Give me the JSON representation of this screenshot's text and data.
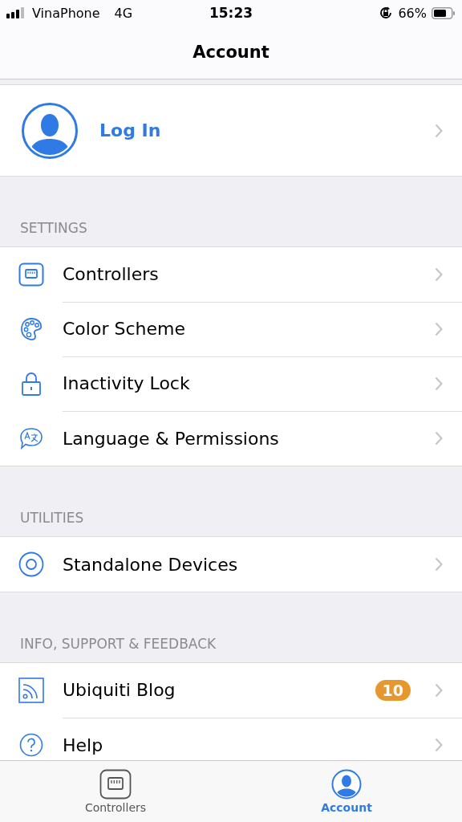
{
  "status_bar": {
    "carrier": "VinaPhone",
    "network": "4G",
    "time": "15:23",
    "battery": "66%"
  },
  "nav": {
    "title": "Account"
  },
  "login": {
    "label": "Log In"
  },
  "sections": [
    {
      "header": "SETTINGS",
      "items": [
        {
          "label": "Controllers"
        },
        {
          "label": "Color Scheme"
        },
        {
          "label": "Inactivity Lock"
        },
        {
          "label": "Language & Permissions"
        }
      ]
    },
    {
      "header": "UTILITIES",
      "items": [
        {
          "label": "Standalone Devices"
        }
      ]
    },
    {
      "header": "INFO, SUPPORT & FEEDBACK",
      "items": [
        {
          "label": "Ubiquiti Blog",
          "badge": "10"
        },
        {
          "label": "Help"
        }
      ]
    }
  ],
  "tabs": [
    {
      "label": "Controllers",
      "selected": false
    },
    {
      "label": "Account",
      "selected": true
    }
  ]
}
